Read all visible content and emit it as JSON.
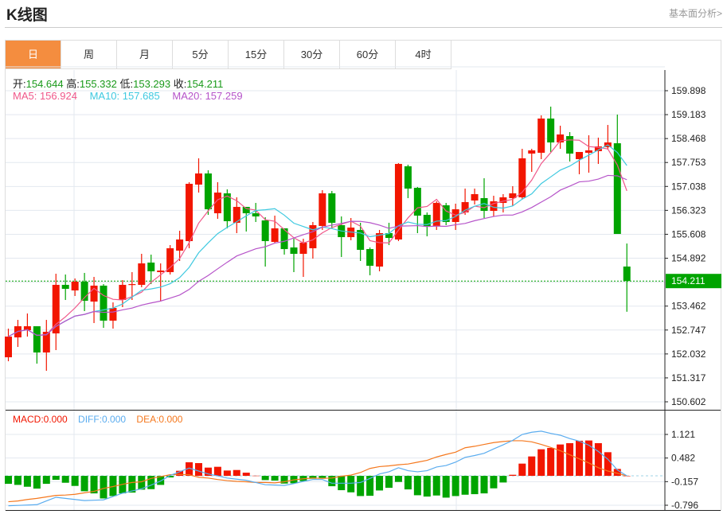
{
  "header": {
    "title": "K线图",
    "link": "基本面分析>"
  },
  "tabs": [
    {
      "label": "日",
      "active": true
    },
    {
      "label": "周"
    },
    {
      "label": "月"
    },
    {
      "label": "5分"
    },
    {
      "label": "15分"
    },
    {
      "label": "30分"
    },
    {
      "label": "60分"
    },
    {
      "label": "4时"
    }
  ],
  "ohlc": {
    "open_label": "开:",
    "open": "154.644",
    "high_label": "高:",
    "high": "155.332",
    "low_label": "低:",
    "low": "153.293",
    "close_label": "收:",
    "close": "154.211"
  },
  "ma": {
    "ma5": "MA5: 156.924",
    "ma10": "MA10: 157.685",
    "ma20": "MA20: 157.259"
  },
  "macd_info": {
    "macd": "MACD:0.000",
    "diff": "DIFF:0.000",
    "dea": "DEA:0.000"
  },
  "colors": {
    "up": "#f21600",
    "down": "#00a400",
    "ma5": "#f0588a",
    "ma10": "#3fc9e0",
    "ma20": "#b654c9",
    "diff": "#5aacef",
    "dea": "#f5781e",
    "tab_active": "#f48d3f"
  },
  "chart_data": {
    "type": "candlestick",
    "price_axis": {
      "ticks": [
        "159.898",
        "159.183",
        "158.468",
        "157.753",
        "157.038",
        "156.323",
        "155.608",
        "154.892",
        "153.462",
        "152.747",
        "152.032",
        "151.317",
        "150.602"
      ],
      "range": [
        150.602,
        159.898
      ],
      "current_price": "154.211"
    },
    "macd_axis": {
      "ticks": [
        "1.121",
        "0.482",
        "-0.157",
        "-0.796"
      ],
      "range": [
        -0.796,
        1.121
      ]
    },
    "candles": [
      [
        151.933,
        152.789,
        151.814,
        152.551
      ],
      [
        152.527,
        153.05,
        152.242,
        152.86
      ],
      [
        152.741,
        153.241,
        152.551,
        152.86
      ],
      [
        152.86,
        152.86,
        151.743,
        152.076
      ],
      [
        152.076,
        153.05,
        151.529,
        152.694
      ],
      [
        152.646,
        154.429,
        152.147,
        154.097
      ],
      [
        154.097,
        154.406,
        153.645,
        153.978
      ],
      [
        153.93,
        154.287,
        153.764,
        154.192
      ],
      [
        154.192,
        154.453,
        153.312,
        153.621
      ],
      [
        153.597,
        154.334,
        152.955,
        154.073
      ],
      [
        154.073,
        154.12,
        152.813,
        153.027
      ],
      [
        153.027,
        153.573,
        152.789,
        153.407
      ],
      [
        153.645,
        154.239,
        153.431,
        154.097
      ],
      [
        154.097,
        154.477,
        153.645,
        154.12
      ],
      [
        154.097,
        155.024,
        154.025,
        154.738
      ],
      [
        154.762,
        155.0,
        154.12,
        154.501
      ],
      [
        154.477,
        154.738,
        153.597,
        154.524
      ],
      [
        154.477,
        155.285,
        154.406,
        155.19
      ],
      [
        155.119,
        155.713,
        154.81,
        155.452
      ],
      [
        155.404,
        157.164,
        155.19,
        157.116
      ],
      [
        157.092,
        157.877,
        156.854,
        157.425
      ],
      [
        157.425,
        157.52,
        156.189,
        156.355
      ],
      [
        156.236,
        157.164,
        156.07,
        156.854
      ],
      [
        156.831,
        156.95,
        155.785,
        155.999
      ],
      [
        155.951,
        156.712,
        155.642,
        156.426
      ],
      [
        156.426,
        156.426,
        155.69,
        156.236
      ],
      [
        156.236,
        156.545,
        155.975,
        156.141
      ],
      [
        156.022,
        156.117,
        154.643,
        155.404
      ],
      [
        155.38,
        156.165,
        155.333,
        155.785
      ],
      [
        155.785,
        155.785,
        155.0,
        155.166
      ],
      [
        155.214,
        155.475,
        154.477,
        155.024
      ],
      [
        155.024,
        155.475,
        154.334,
        155.357
      ],
      [
        155.19,
        155.975,
        154.881,
        155.88
      ],
      [
        155.856,
        156.926,
        155.737,
        156.831
      ],
      [
        156.831,
        156.902,
        155.785,
        155.951
      ],
      [
        155.88,
        156.141,
        154.929,
        155.523
      ],
      [
        155.523,
        156.094,
        155.428,
        155.808
      ],
      [
        155.737,
        155.951,
        154.81,
        155.143
      ],
      [
        155.166,
        155.214,
        154.382,
        154.667
      ],
      [
        154.643,
        155.737,
        154.501,
        155.642
      ],
      [
        155.642,
        155.951,
        155.285,
        155.499
      ],
      [
        155.452,
        157.734,
        155.404,
        157.71
      ],
      [
        157.639,
        157.687,
        156.688,
        156.973
      ],
      [
        156.997,
        157.021,
        155.642,
        156.165
      ],
      [
        156.189,
        156.26,
        155.547,
        155.856
      ],
      [
        155.856,
        156.593,
        155.737,
        156.545
      ],
      [
        156.474,
        156.545,
        155.88,
        155.975
      ],
      [
        155.975,
        156.522,
        155.737,
        156.355
      ],
      [
        156.26,
        156.973,
        156.189,
        156.569
      ],
      [
        156.617,
        156.973,
        156.498,
        156.807
      ],
      [
        156.688,
        157.282,
        156.094,
        156.308
      ],
      [
        156.308,
        156.759,
        156.141,
        156.593
      ],
      [
        156.545,
        156.807,
        156.26,
        156.712
      ],
      [
        156.688,
        157.045,
        156.45,
        156.831
      ],
      [
        156.712,
        158.162,
        156.664,
        157.877
      ],
      [
        158.019,
        158.162,
        157.473,
        158.115
      ],
      [
        158.043,
        159.161,
        157.853,
        159.066
      ],
      [
        159.066,
        159.422,
        158.067,
        158.352
      ],
      [
        158.352,
        158.852,
        158.162,
        158.59
      ],
      [
        158.542,
        158.661,
        157.782,
        158.019
      ],
      [
        157.853,
        158.067,
        157.401,
        158.067
      ],
      [
        158.043,
        158.566,
        157.449,
        158.115
      ],
      [
        158.091,
        158.495,
        157.71,
        158.233
      ],
      [
        158.21,
        158.875,
        158.138,
        158.352
      ],
      [
        158.328,
        159.184,
        155.618,
        155.618
      ],
      [
        154.644,
        155.332,
        153.293,
        154.211
      ]
    ],
    "macd_hist": [
      -0.216,
      -0.245,
      -0.295,
      -0.345,
      -0.216,
      -0.108,
      -0.187,
      -0.273,
      -0.417,
      -0.475,
      -0.612,
      -0.547,
      -0.475,
      -0.453,
      -0.374,
      -0.36,
      -0.245,
      -0.043,
      0.137,
      0.367,
      0.345,
      0.223,
      0.245,
      0.144,
      0.158,
      0.086,
      0.005,
      -0.115,
      -0.129,
      -0.209,
      -0.201,
      -0.144,
      -0.079,
      -0.058,
      -0.281,
      -0.388,
      -0.446,
      -0.547,
      -0.54,
      -0.396,
      -0.324,
      -0.165,
      -0.367,
      -0.525,
      -0.561,
      -0.532,
      -0.59,
      -0.547,
      -0.511,
      -0.496,
      -0.475,
      -0.338,
      -0.18,
      0.029,
      0.331,
      0.525,
      0.719,
      0.755,
      0.849,
      0.885,
      0.95,
      0.957,
      0.885,
      0.64,
      0.187,
      0.0
    ],
    "diff": [
      -0.81,
      -0.8,
      -0.79,
      -0.78,
      -0.68,
      -0.58,
      -0.61,
      -0.64,
      -0.67,
      -0.66,
      -0.65,
      -0.56,
      -0.47,
      -0.41,
      -0.35,
      -0.25,
      -0.14,
      0.01,
      0.11,
      0.21,
      0.13,
      0.05,
      0.0,
      -0.06,
      -0.09,
      -0.12,
      -0.18,
      -0.24,
      -0.25,
      -0.26,
      -0.21,
      -0.15,
      -0.1,
      -0.1,
      -0.2,
      -0.2,
      -0.2,
      -0.18,
      -0.07,
      0.05,
      0.11,
      0.22,
      0.14,
      0.11,
      0.14,
      0.24,
      0.28,
      0.37,
      0.5,
      0.55,
      0.61,
      0.73,
      0.84,
      0.96,
      1.12,
      1.18,
      1.21,
      1.15,
      1.1,
      1.01,
      0.94,
      0.83,
      0.66,
      0.45,
      0.16,
      0.0
    ],
    "dea": [
      -0.7,
      -0.68,
      -0.64,
      -0.61,
      -0.57,
      -0.53,
      -0.52,
      -0.5,
      -0.46,
      -0.42,
      -0.34,
      -0.29,
      -0.23,
      -0.18,
      -0.16,
      -0.07,
      -0.02,
      0.03,
      0.04,
      0.03,
      -0.04,
      -0.06,
      -0.1,
      -0.13,
      -0.15,
      -0.16,
      -0.18,
      -0.18,
      -0.19,
      -0.16,
      -0.11,
      -0.08,
      -0.06,
      -0.07,
      -0.06,
      -0.01,
      0.02,
      0.09,
      0.2,
      0.25,
      0.27,
      0.3,
      0.32,
      0.37,
      0.42,
      0.51,
      0.58,
      0.64,
      0.76,
      0.8,
      0.85,
      0.9,
      0.93,
      0.95,
      0.95,
      0.92,
      0.85,
      0.77,
      0.68,
      0.57,
      0.46,
      0.35,
      0.22,
      0.13,
      0.07,
      0.0
    ]
  }
}
